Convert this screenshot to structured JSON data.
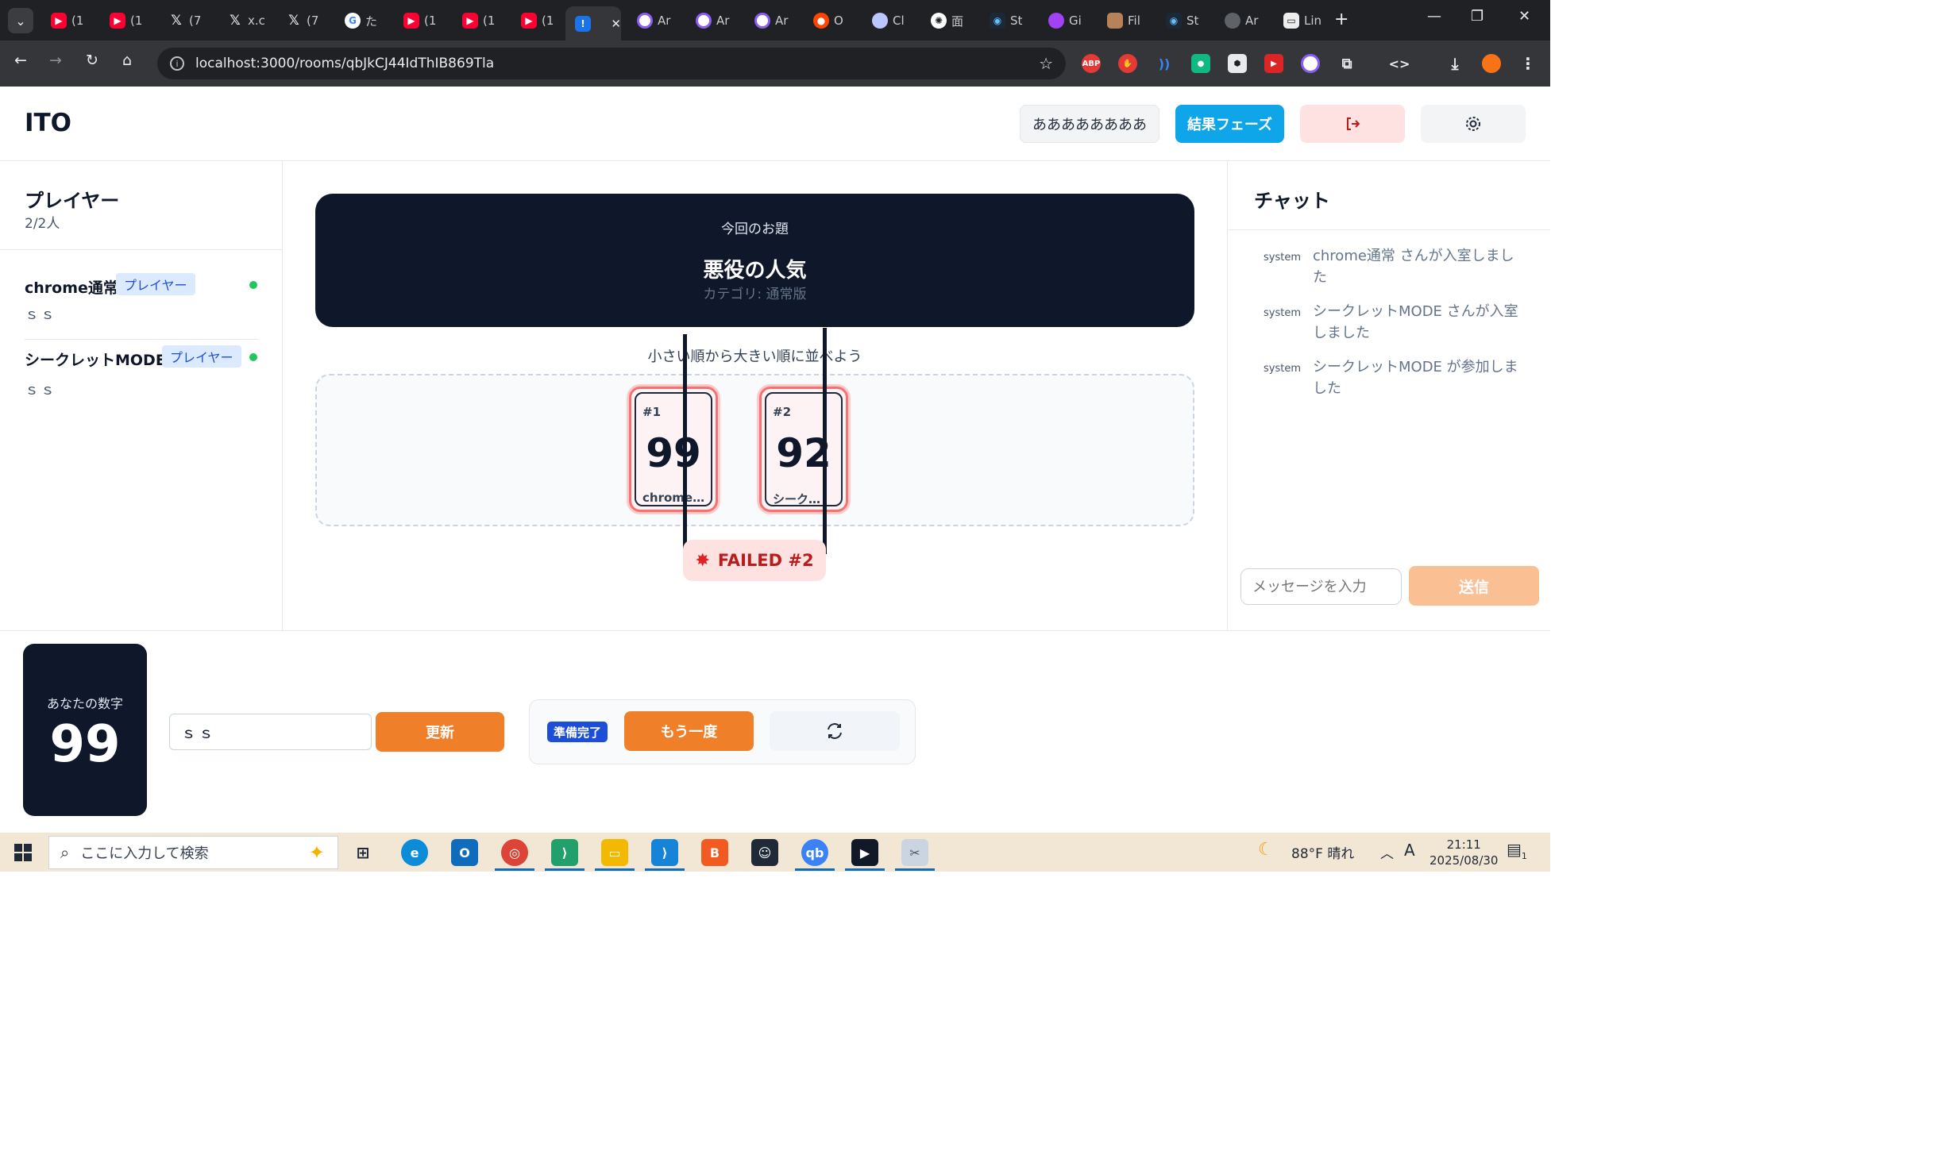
{
  "browser": {
    "tabs": [
      {
        "label": "(1",
        "icon": "youtube-icon"
      },
      {
        "label": "(1",
        "icon": "youtube-icon"
      },
      {
        "label": "(7",
        "icon": "x-icon"
      },
      {
        "label": "x.c",
        "icon": "x-icon"
      },
      {
        "label": "(7",
        "icon": "x-icon"
      },
      {
        "label": "た",
        "icon": "google-icon"
      },
      {
        "label": "(1",
        "icon": "youtube-icon"
      },
      {
        "label": "(1",
        "icon": "youtube-icon"
      },
      {
        "label": "(1",
        "icon": "youtube-icon"
      },
      {
        "label": "",
        "icon": "localhost-icon",
        "active": true
      },
      {
        "label": "Ar",
        "icon": "arc-icon"
      },
      {
        "label": "Ar",
        "icon": "arc-icon"
      },
      {
        "label": "Ar",
        "icon": "arc-icon"
      },
      {
        "label": "O",
        "icon": "reddit-icon"
      },
      {
        "label": "Cl",
        "icon": "claude-icon"
      },
      {
        "label": "面",
        "icon": "openai-icon"
      },
      {
        "label": "St",
        "icon": "steam-icon"
      },
      {
        "label": "Gi",
        "icon": "gemini-icon"
      },
      {
        "label": "Fil",
        "icon": "file-icon"
      },
      {
        "label": "St",
        "icon": "steam-icon"
      },
      {
        "label": "Ar",
        "icon": "globe-icon"
      },
      {
        "label": "Lin",
        "icon": "link-icon"
      }
    ],
    "url": "localhost:3000/rooms/qbJkCJ44IdThIB869Tla"
  },
  "app": {
    "logo": "ITO",
    "header": {
      "name_button": "ああああああああ",
      "phase_button": "結果フェーズ"
    },
    "players_panel": {
      "title": "プレイヤー",
      "count": "2/2人",
      "players": [
        {
          "name": "chrome通常",
          "role": "プレイヤー",
          "clue": "ｓｓ",
          "online": true
        },
        {
          "name": "シークレットMODE",
          "role": "プレイヤー",
          "clue": "ｓｓ",
          "online": true
        }
      ]
    },
    "topic": {
      "label": "今回のお題",
      "title": "悪役の人気",
      "category": "カテゴリ: 通常版"
    },
    "board": {
      "hint": "小さい順から大きい順に並べよう",
      "cards": [
        {
          "index": "#1",
          "number": "99",
          "owner": "chrome…"
        },
        {
          "index": "#2",
          "number": "92",
          "owner": "シーク…"
        }
      ],
      "result": "FAILED #2"
    },
    "chat": {
      "title": "チャット",
      "messages": [
        {
          "sender": "system",
          "text": "chrome通常 さんが入室しました"
        },
        {
          "sender": "system",
          "text": "シークレットMODE さんが入室しました"
        },
        {
          "sender": "system",
          "text": "シークレットMODE が参加しました"
        }
      ],
      "input_placeholder": "メッセージを入力",
      "send_label": "送信"
    },
    "bottom": {
      "my_number_label": "あなたの数字",
      "my_number": "99",
      "clue_value": "ｓｓ",
      "update_label": "更新",
      "ready_badge": "準備完了",
      "again_label": "もう一度"
    }
  },
  "taskbar": {
    "search_placeholder": "ここに入力して検索",
    "weather": "88°F  晴れ",
    "ime": "A",
    "time": "21:11",
    "date": "2025/08/30",
    "notification_count": "1"
  }
}
